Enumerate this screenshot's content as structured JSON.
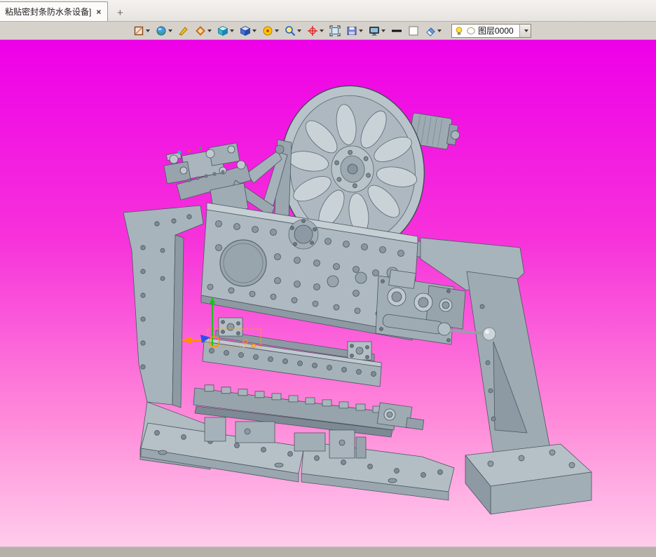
{
  "tabbar": {
    "tabs": [
      {
        "title": "粘贴密封条防水条设备]",
        "close_label": "×"
      }
    ],
    "new_tab_label": "+"
  },
  "toolbar": {
    "icons": [
      {
        "name": "sketch-sheet-tool",
        "color": "#8b4513",
        "has_dropdown": true
      },
      {
        "name": "material-sphere-tool",
        "color": "#3da0e0",
        "has_dropdown": true
      },
      {
        "name": "knife-tool",
        "color": "#f0c020",
        "has_dropdown": false
      },
      {
        "name": "paint-tool",
        "color": "#f09030",
        "has_dropdown": true
      },
      {
        "name": "cube-cyan-tool",
        "color": "#32b8d8",
        "has_dropdown": true
      },
      {
        "name": "cube-blue-tool",
        "color": "#4070e0",
        "has_dropdown": true
      },
      {
        "name": "gear-tool",
        "color": "#f8c800",
        "has_dropdown": true
      },
      {
        "name": "zoom-tool",
        "color": "#2060c0",
        "has_dropdown": true
      },
      {
        "name": "snap-target-tool",
        "color": "#e02020",
        "has_dropdown": true
      },
      {
        "name": "fit-view-tool",
        "color": "#406080",
        "has_dropdown": false
      },
      {
        "name": "disk-tool",
        "color": "#7080d0",
        "has_dropdown": true
      },
      {
        "name": "display-style-tool",
        "color": "#405060",
        "has_dropdown": true
      },
      {
        "name": "line-width-tool",
        "color": "#101010",
        "has_dropdown": false
      },
      {
        "name": "color-swatch-tool",
        "color": "#ffffff",
        "has_dropdown": false
      },
      {
        "name": "eraser-tool",
        "color": "#60a0e0",
        "has_dropdown": true
      }
    ],
    "layer_combo": {
      "value": "图层0000"
    }
  },
  "viewport": {
    "background_top": "#ee00e8",
    "background_bottom": "#ffccec",
    "model_name": "sealing-strip-machine-assembly",
    "model_color": "#aab5bd"
  },
  "statusbar": {
    "text": ""
  }
}
